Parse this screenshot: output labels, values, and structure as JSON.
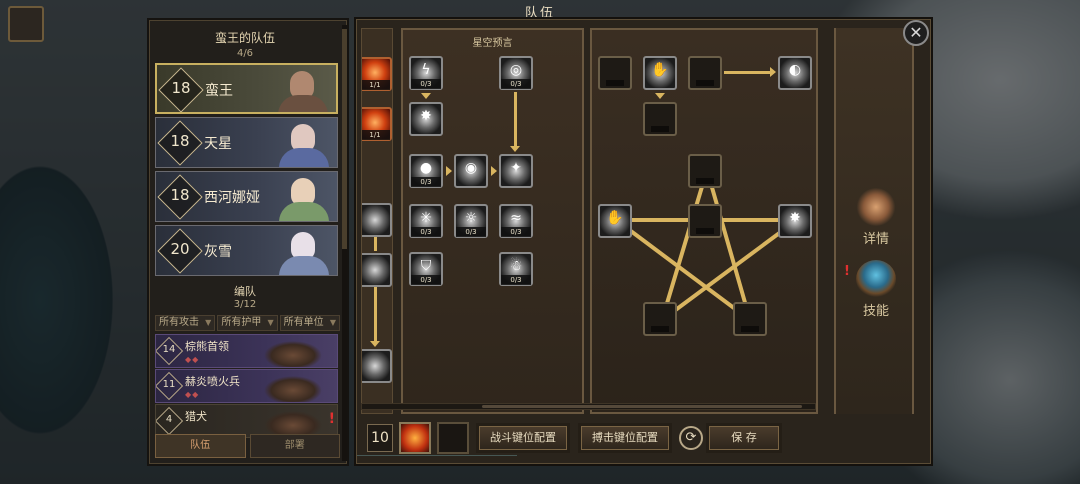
{
  "window": {
    "title": "队伍"
  },
  "team": {
    "header": "蛮王的队伍",
    "count": "4/6",
    "heroes": [
      {
        "level": "18",
        "name": "蛮王",
        "active": true,
        "face": "#b08870",
        "body": "#6a5040"
      },
      {
        "level": "18",
        "name": "天星",
        "active": false,
        "face": "#e0c8c0",
        "body": "#5a6aa0"
      },
      {
        "level": "18",
        "name": "西河娜娅",
        "active": false,
        "face": "#e8d0b8",
        "body": "#7a9a6a"
      },
      {
        "level": "20",
        "name": "灰雪",
        "active": false,
        "face": "#e8e0e8",
        "body": "#7a8ab0"
      }
    ]
  },
  "formation": {
    "header": "编队",
    "count": "3/12",
    "filters": [
      "所有攻击",
      "所有护甲",
      "所有单位"
    ],
    "units": [
      {
        "level": "14",
        "name": "棕熊首领",
        "gems": "◆◆",
        "alert": false,
        "style": "purple"
      },
      {
        "level": "11",
        "name": "赫炎喷火兵",
        "gems": "◆◆",
        "alert": false,
        "style": "purple"
      },
      {
        "level": "4",
        "name": "猎犬",
        "gems": "",
        "alert": true,
        "style": "plain"
      }
    ],
    "tabs": [
      "队伍",
      "部署"
    ]
  },
  "talents": {
    "tree_title": "星空预言",
    "column_a_ranks": [
      "1/1",
      "1/1"
    ],
    "ranks": {
      "r1": "0/3",
      "r2": "0/3",
      "r3": "0/3",
      "r4": "0/3",
      "r5": "0/3",
      "r6": "0/3",
      "r7": "0/3",
      "r8": "0/3",
      "r9": "0/3",
      "r10": "0/3"
    }
  },
  "side": {
    "details_label": "详情",
    "skills_label": "技能"
  },
  "bottom_bar": {
    "level": "10",
    "battle_keys_label": "战斗键位配置",
    "grapple_keys_label": "搏击键位配置",
    "save_label": "保 存"
  },
  "colors": {
    "link": "#d9b560",
    "panel": "#2a241c",
    "border": "#6a5840",
    "alert": "#e03030"
  }
}
